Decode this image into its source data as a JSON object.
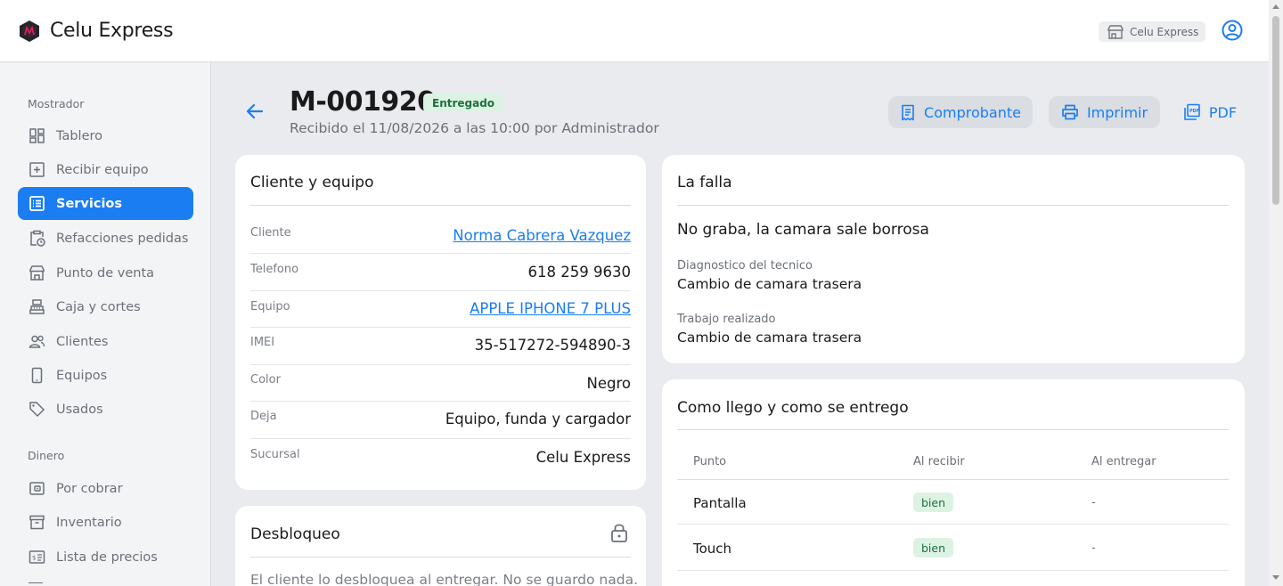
{
  "app": {
    "name": "Celu Express",
    "store_chip": "Celu Express"
  },
  "sidebar": {
    "sections": [
      {
        "title": "Mostrador"
      },
      {
        "title": "Dinero"
      }
    ],
    "items": [
      {
        "label": "Tablero",
        "icon": "dashboard-icon"
      },
      {
        "label": "Recibir equipo",
        "icon": "plus-square-icon"
      },
      {
        "label": "Servicios",
        "icon": "list-icon",
        "active": true
      },
      {
        "label": "Refacciones pedidas",
        "icon": "clipboard-clock-icon"
      },
      {
        "label": "Punto de venta",
        "icon": "store-icon"
      },
      {
        "label": "Caja y cortes",
        "icon": "cash-register-icon"
      },
      {
        "label": "Clientes",
        "icon": "users-icon"
      },
      {
        "label": "Equipos",
        "icon": "phone-icon"
      },
      {
        "label": "Usados",
        "icon": "tag-icon"
      },
      {
        "label": "Por cobrar",
        "icon": "wallet-icon"
      },
      {
        "label": "Inventario",
        "icon": "archive-icon"
      },
      {
        "label": "Lista de precios",
        "icon": "price-list-icon"
      }
    ]
  },
  "header": {
    "order_id": "M-001920",
    "status": "Entregado",
    "subtitle": "Recibido el 11/08/2026 a las 10:00 por Administrador",
    "buttons": {
      "receipt": "Comprobante",
      "print": "Imprimir",
      "pdf": "PDF"
    }
  },
  "client_card": {
    "title": "Cliente y equipo",
    "rows": [
      {
        "label": "Cliente",
        "value": "Norma Cabrera Vazquez",
        "link": true
      },
      {
        "label": "Telefono",
        "value": "618 259 9630"
      },
      {
        "label": "Equipo",
        "value": "APPLE IPHONE 7 PLUS",
        "link": true
      },
      {
        "label": "IMEI",
        "value": "35-517272-594890-3"
      },
      {
        "label": "Color",
        "value": "Negro"
      },
      {
        "label": "Deja",
        "value": "Equipo, funda y cargador"
      },
      {
        "label": "Sucursal",
        "value": "Celu Express"
      }
    ]
  },
  "fault_card": {
    "title": "La falla",
    "description": "No graba, la camara sale borrosa",
    "diagnosis_label": "Diagnostico del tecnico",
    "diagnosis": "Cambio de camara trasera",
    "work_label": "Trabajo realizado",
    "work": "Cambio de camara trasera"
  },
  "unlock_card": {
    "title": "Desbloqueo",
    "note": "El cliente lo desbloquea al entregar. No se guardo nada."
  },
  "condition_card": {
    "title": "Como llego y como se entrego",
    "columns": [
      "Punto",
      "Al recibir",
      "Al entregar"
    ],
    "rows": [
      {
        "point": "Pantalla",
        "received": "bien",
        "delivered": "-"
      },
      {
        "point": "Touch",
        "received": "bien",
        "delivered": "-"
      }
    ]
  },
  "colors": {
    "accent": "#1a7ef2",
    "success_bg": "#dcf3e3",
    "success_fg": "#1f6f3f"
  }
}
